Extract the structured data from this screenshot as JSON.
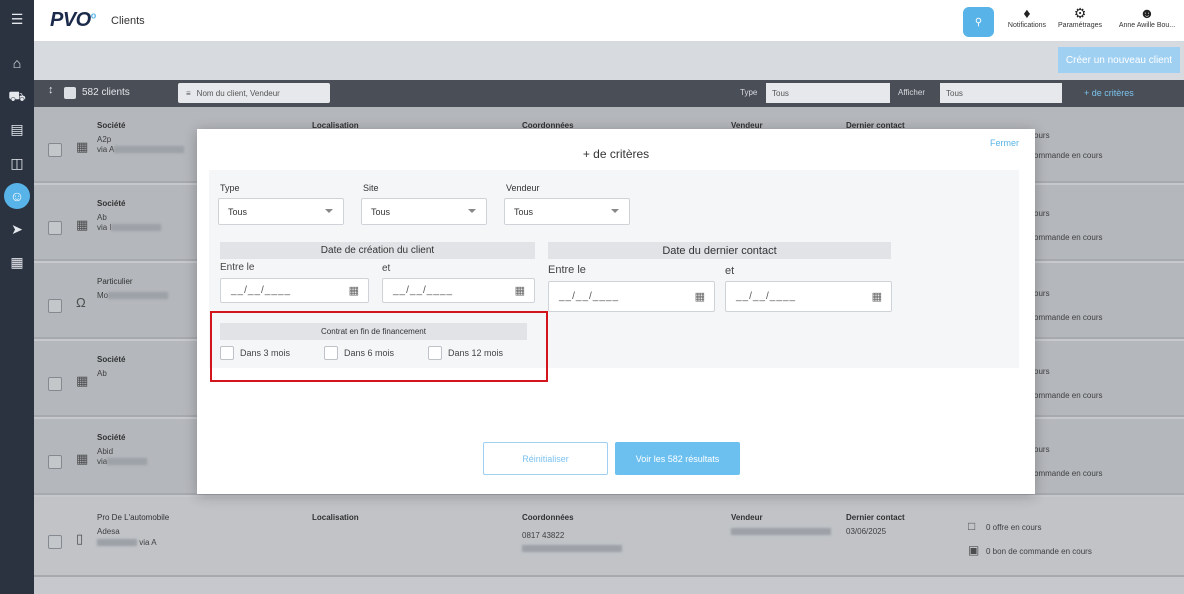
{
  "app": {
    "logo": "PVO",
    "logo_mark": "o",
    "section": "Clients"
  },
  "topbar": {
    "search_icon": "search-icon",
    "notifications_label": "Notifications",
    "settings_label": "Paramétrages",
    "user_label": "Anne Awille Bou..."
  },
  "strip": {
    "create_label": "Créer un nouveau client"
  },
  "filterbar": {
    "count": "582 clients",
    "search_placeholder": "Nom du client, Vendeur",
    "type_label": "Type",
    "type_value": "Tous",
    "show_label": "Afficher",
    "show_value": "Tous",
    "more_criteria": "+ de critères"
  },
  "rows": [
    {
      "type": "Société",
      "name": "A2p",
      "via": "via A",
      "col_headers": [
        "Localisation",
        "Coordonnées",
        "Vendeur",
        "Dernier contact"
      ],
      "right1": "ours",
      "right2": "ommande en cours"
    },
    {
      "type": "Société",
      "name": "Ab",
      "via": "via l",
      "right1": "ours",
      "right2": "ommande en cours"
    },
    {
      "type": "Particulier",
      "name": "Mo",
      "via": "",
      "right1": "ours",
      "right2": "ommande en cours"
    },
    {
      "type": "Société",
      "name": "Ab",
      "via": "",
      "right1": "ours",
      "right2": "ommande en cours"
    },
    {
      "type": "Société",
      "name": "Abid",
      "via": "via",
      "right1": "ours",
      "right2": "ommande en cours"
    },
    {
      "type": "Pro De L'automobile",
      "name": "Adesa",
      "via": "via A",
      "h_loc": "Localisation",
      "h_coord": "Coordonnées",
      "coord_value": "0817 43822",
      "h_seller": "Vendeur",
      "h_contact": "Dernier contact",
      "contact_value": "03/06/2025",
      "right1": "0 offre en cours",
      "right2": "0 bon de commande en cours"
    }
  ],
  "modal": {
    "title": "+ de critères",
    "close_label": "Fermer",
    "type_label": "Type",
    "type_value": "Tous",
    "site_label": "Site",
    "site_value": "Tous",
    "seller_label": "Vendeur",
    "seller_value": "Tous",
    "creation_header": "Date de création du client",
    "creation_from_label": "Entre le",
    "creation_to_label": "et",
    "creation_from_value": "__/__/____",
    "creation_to_value": "__/__/____",
    "contact_header": "Date du dernier contact",
    "contact_from_label": "Entre le",
    "contact_to_label": "et",
    "contact_from_value": "__/__/____",
    "contact_to_value": "__/__/____",
    "contract_header": "Contrat en fin de financement",
    "opt_3": "Dans 3 mois",
    "opt_6": "Dans 6 mois",
    "opt_12": "Dans 12 mois",
    "reset_label": "Réinitialiser",
    "see_label": "Voir les 582 résultats"
  },
  "colors": {
    "accent": "#58b4e8",
    "highlight": "#d4141c",
    "rail": "#2b3240"
  }
}
